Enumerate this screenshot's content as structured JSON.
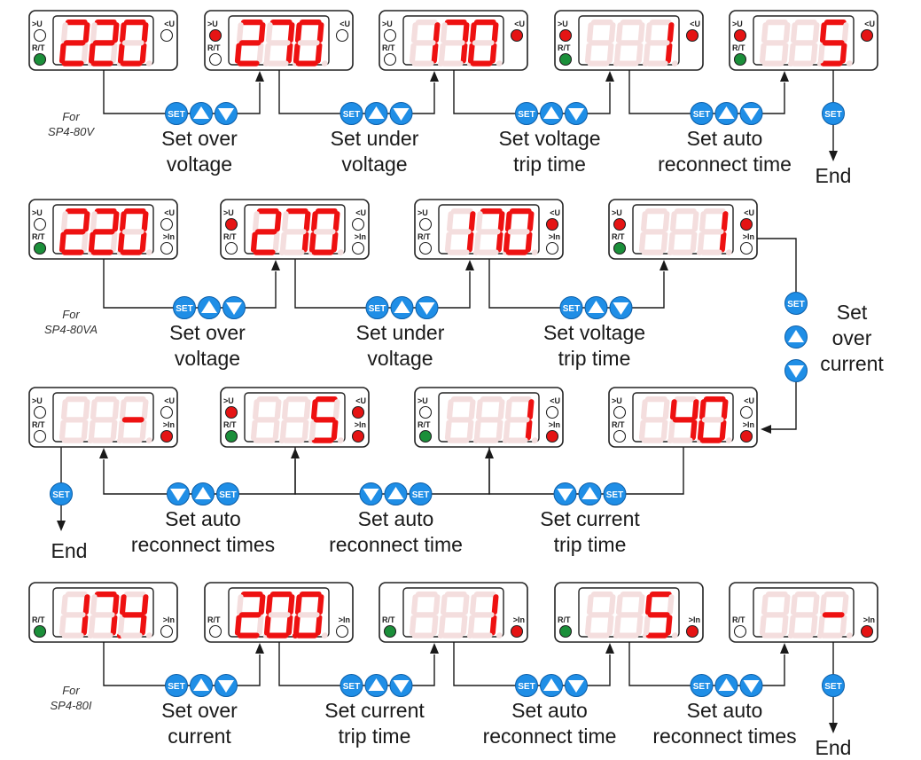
{
  "colors": {
    "segment_on": "#ee1111",
    "segment_off": "#f4dede",
    "led_red": "#e51414",
    "led_green": "#1b8f3a",
    "led_off": "#ffffff",
    "button_blue": "#1f8ee6",
    "line": "#1a1a1a"
  },
  "buttons": {
    "set": "SET"
  },
  "end_label": "End",
  "sections": [
    {
      "model_prefix": "For",
      "model": "SP4-80V",
      "labels": {
        "tl": ">U",
        "bl": "R/T",
        "tr": "<U",
        "br": ""
      },
      "devices": [
        {
          "digits": "220",
          "leds": {
            "tl": "off",
            "bl": "green",
            "tr": "off"
          }
        },
        {
          "digits": "270",
          "leds": {
            "tl": "red",
            "bl": "off",
            "tr": "off"
          }
        },
        {
          "digits": "170",
          "leds": {
            "tl": "off",
            "bl": "off",
            "tr": "red"
          }
        },
        {
          "digits": "  1",
          "leds": {
            "tl": "red",
            "bl": "green",
            "tr": "red"
          }
        },
        {
          "digits": "  5",
          "leds": {
            "tl": "red",
            "bl": "green",
            "tr": "red"
          }
        }
      ],
      "steps": [
        [
          "Set over",
          "voltage"
        ],
        [
          "Set under",
          "voltage"
        ],
        [
          "Set voltage",
          "trip time"
        ],
        [
          "Set auto",
          "reconnect time"
        ]
      ]
    },
    {
      "model_prefix": "For",
      "model": "SP4-80VA",
      "labels": {
        "tl": ">U",
        "bl": "R/T",
        "tr": "<U",
        "br": ">In"
      },
      "devices": [
        {
          "digits": "220",
          "leds": {
            "tl": "off",
            "bl": "green",
            "tr": "off",
            "br": "off"
          }
        },
        {
          "digits": "270",
          "leds": {
            "tl": "red",
            "bl": "off",
            "tr": "off",
            "br": "off"
          }
        },
        {
          "digits": "170",
          "leds": {
            "tl": "off",
            "bl": "off",
            "tr": "red",
            "br": "off"
          }
        },
        {
          "digits": "  1",
          "leds": {
            "tl": "red",
            "bl": "green",
            "tr": "red",
            "br": "off"
          }
        }
      ],
      "steps": [
        [
          "Set over",
          "voltage"
        ],
        [
          "Set under",
          "voltage"
        ],
        [
          "Set voltage",
          "trip time"
        ]
      ],
      "side_step": [
        "Set",
        "over",
        "current"
      ]
    },
    {
      "labels": {
        "tl": ">U",
        "bl": "R/T",
        "tr": "<U",
        "br": ">In"
      },
      "devices": [
        {
          "digits": "  -",
          "leds": {
            "tl": "off",
            "bl": "off",
            "tr": "off",
            "br": "red"
          }
        },
        {
          "digits": "  5",
          "leds": {
            "tl": "red",
            "bl": "green",
            "tr": "red",
            "br": "red"
          }
        },
        {
          "digits": "  1",
          "leds": {
            "tl": "off",
            "bl": "green",
            "tr": "off",
            "br": "red"
          }
        },
        {
          "digits": " 40",
          "leds": {
            "tl": "off",
            "bl": "off",
            "tr": "off",
            "br": "red"
          }
        }
      ],
      "steps": [
        [
          "Set auto",
          "reconnect times"
        ],
        [
          "Set auto",
          "reconnect time"
        ],
        [
          "Set current",
          "trip time"
        ]
      ]
    },
    {
      "model_prefix": "For",
      "model": "SP4-80I",
      "labels": {
        "tl": "",
        "bl": "R/T",
        "tr": "",
        "br": ">In"
      },
      "devices": [
        {
          "digits": "17.4",
          "leds": {
            "bl": "green",
            "br": "off"
          }
        },
        {
          "digits": "20.0",
          "leds": {
            "bl": "off",
            "br": "off"
          }
        },
        {
          "digits": "  1",
          "leds": {
            "bl": "green",
            "br": "red"
          }
        },
        {
          "digits": "  5",
          "leds": {
            "bl": "green",
            "br": "red"
          }
        },
        {
          "digits": "  -",
          "leds": {
            "bl": "off",
            "br": "red"
          }
        }
      ],
      "steps": [
        [
          "Set over",
          "current"
        ],
        [
          "Set current",
          "trip time"
        ],
        [
          "Set auto",
          "reconnect time"
        ],
        [
          "Set auto",
          "reconnect times"
        ]
      ]
    }
  ]
}
